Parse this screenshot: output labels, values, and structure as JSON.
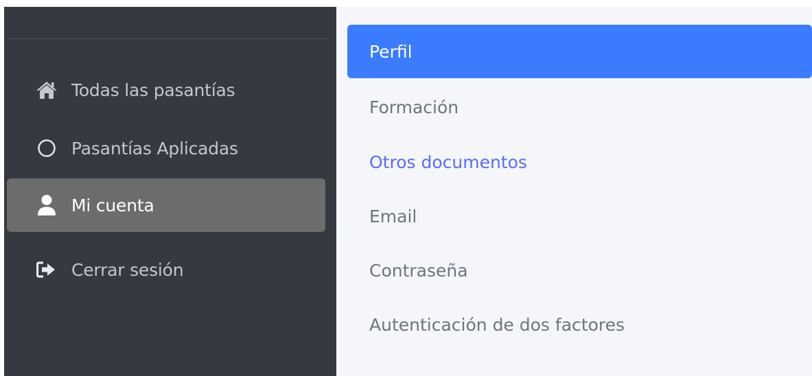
{
  "sidebar": {
    "items": [
      {
        "label": "Todas las pasantías",
        "icon": "home-icon",
        "active": false
      },
      {
        "label": "Pasantías Aplicadas",
        "icon": "circle-icon",
        "active": false
      },
      {
        "label": "Mi cuenta",
        "icon": "user-icon",
        "active": true
      },
      {
        "label": "Cerrar sesión",
        "icon": "sign-out-icon",
        "active": false
      }
    ]
  },
  "account_tabs": {
    "items": [
      {
        "label": "Perfil",
        "active": true
      },
      {
        "label": "Formación",
        "active": false
      },
      {
        "label": "Otros documentos",
        "active": false
      },
      {
        "label": "Email",
        "active": false
      },
      {
        "label": "Contraseña",
        "active": false
      },
      {
        "label": "Autenticación de dos factores",
        "active": false
      }
    ]
  },
  "colors": {
    "sidebar_bg": "#343a40",
    "sidebar_active_bg": "#6c6c6c",
    "content_bg": "#f4f6f9",
    "tab_active_bg": "#3b7cff",
    "tab_text": "#6c757d",
    "link_text": "#5b6bff"
  }
}
